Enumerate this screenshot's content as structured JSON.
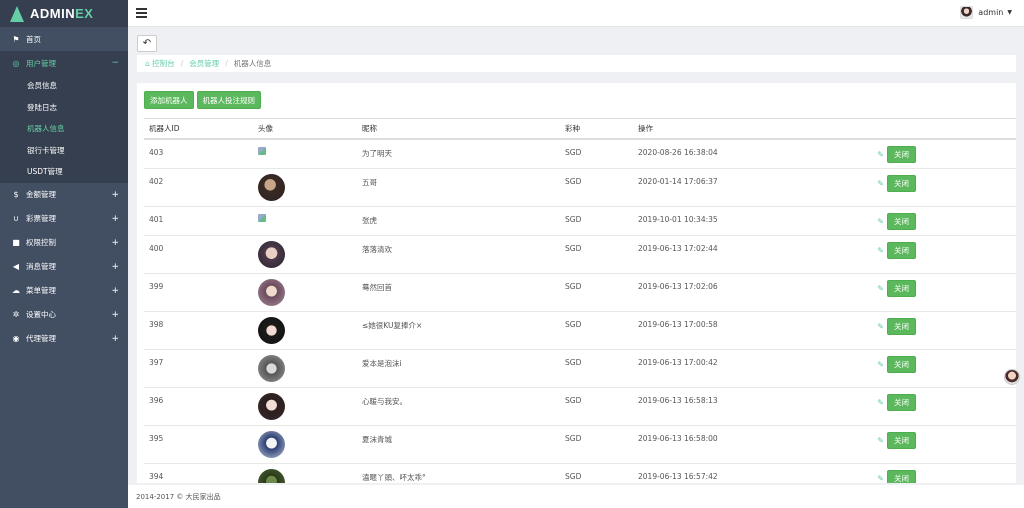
{
  "app": {
    "logo_prefix": "ADMIN",
    "logo_suffix": "EX"
  },
  "sidebar": {
    "items": [
      {
        "label": "首页",
        "icon": "flag-icon"
      },
      {
        "label": "用户管理",
        "icon": "user-circle-icon",
        "toggle": "−"
      },
      {
        "label": "金额管理",
        "icon": "dollar-icon",
        "toggle": "+"
      },
      {
        "label": "彩票管理",
        "icon": "magnet-icon",
        "toggle": "+"
      },
      {
        "label": "权限控制",
        "icon": "lock-icon",
        "toggle": "+"
      },
      {
        "label": "消息管理",
        "icon": "bullhorn-icon",
        "toggle": "+"
      },
      {
        "label": "菜单管理",
        "icon": "cloud-icon",
        "toggle": "+"
      },
      {
        "label": "设置中心",
        "icon": "gear-icon",
        "toggle": "+"
      },
      {
        "label": "代理管理",
        "icon": "circle-user-icon",
        "toggle": "+"
      }
    ],
    "sub_items": [
      {
        "label": "会员信息"
      },
      {
        "label": "登陆日志"
      },
      {
        "label": "机器人信息"
      },
      {
        "label": "银行卡管理"
      },
      {
        "label": "USDT管理"
      }
    ]
  },
  "header": {
    "user_name": "admin"
  },
  "breadcrumb": {
    "home": "控制台",
    "section": "会员管理",
    "current": "机器人信息"
  },
  "toolbar": {
    "add_label": "添加机器人",
    "rules_label": "机器人投注规则"
  },
  "table": {
    "columns": [
      "机器人ID",
      "头像",
      "昵称",
      "彩种",
      "操作"
    ],
    "rows": [
      {
        "id": "403",
        "avatar": "broken",
        "nick": "为了明天",
        "type": "SGD",
        "time": "2020-08-26 16:38:04",
        "action": "关闭"
      },
      {
        "id": "402",
        "avatar": "photo",
        "nick": "五哥",
        "type": "SGD",
        "time": "2020-01-14 17:06:37",
        "action": "关闭"
      },
      {
        "id": "401",
        "avatar": "broken",
        "nick": "张虎",
        "type": "SGD",
        "time": "2019-10-01 10:34:35",
        "action": "关闭"
      },
      {
        "id": "400",
        "avatar": "photo",
        "nick": "落落清欢",
        "type": "SGD",
        "time": "2019-06-13 17:02:44",
        "action": "关闭"
      },
      {
        "id": "399",
        "avatar": "photo",
        "nick": "蓦然回首",
        "type": "SGD",
        "time": "2019-06-13 17:02:06",
        "action": "关闭"
      },
      {
        "id": "398",
        "avatar": "photo",
        "nick": "≤她很KU复捧介×",
        "type": "SGD",
        "time": "2019-06-13 17:00:58",
        "action": "关闭"
      },
      {
        "id": "397",
        "avatar": "photo",
        "nick": "爱本是泡沫i",
        "type": "SGD",
        "time": "2019-06-13 17:00:42",
        "action": "关闭"
      },
      {
        "id": "396",
        "avatar": "photo",
        "nick": "心暖与我安。",
        "type": "SGD",
        "time": "2019-06-13 16:58:13",
        "action": "关闭"
      },
      {
        "id": "395",
        "avatar": "photo",
        "nick": "夏沫青城",
        "type": "SGD",
        "time": "2019-06-13 16:58:00",
        "action": "关闭"
      },
      {
        "id": "394",
        "avatar": "photo",
        "nick": "溘暱丫頭、吥太乖°",
        "type": "SGD",
        "time": "2019-06-13 16:57:42",
        "action": "关闭"
      }
    ]
  },
  "footer": {
    "text": "2014-2017 © 大民家出品"
  },
  "colors": {
    "sidebar": "#424f63",
    "sidebar_dark": "#353f4f",
    "accent": "#65cea7",
    "button_green": "#5cb85c"
  }
}
